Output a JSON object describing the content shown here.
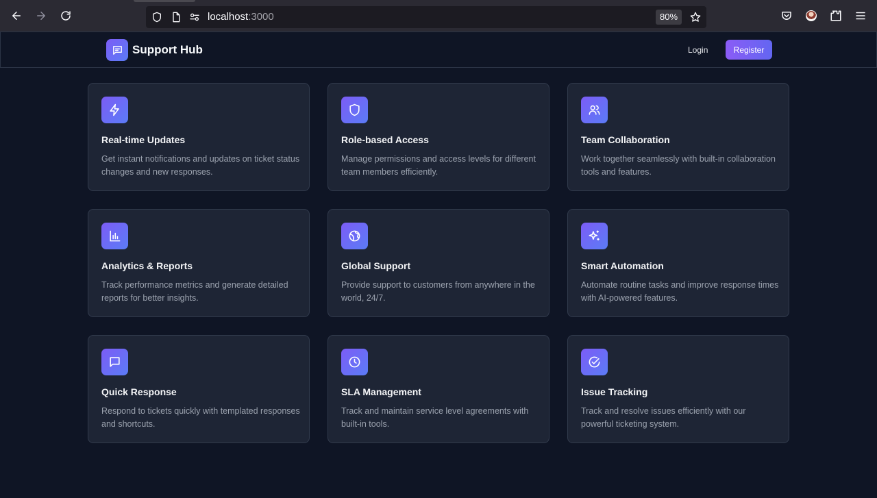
{
  "browser": {
    "url_host": "localhost",
    "url_port": ":3000",
    "zoom": "80%"
  },
  "navbar": {
    "brand": "Support Hub",
    "login_label": "Login",
    "register_label": "Register"
  },
  "features": [
    {
      "title": "Real-time Updates",
      "description": "Get instant notifications and updates on ticket status changes and new responses.",
      "icon": "lightning-icon"
    },
    {
      "title": "Role-based Access",
      "description": "Manage permissions and access levels for different team members efficiently.",
      "icon": "shield-icon"
    },
    {
      "title": "Team Collaboration",
      "description": "Work together seamlessly with built-in collaboration tools and features.",
      "icon": "users-icon"
    },
    {
      "title": "Analytics & Reports",
      "description": "Track performance metrics and generate detailed reports for better insights.",
      "icon": "bar-chart-icon"
    },
    {
      "title": "Global Support",
      "description": "Provide support to customers from anywhere in the world, 24/7.",
      "icon": "globe-icon"
    },
    {
      "title": "Smart Automation",
      "description": "Automate routine tasks and improve response times with AI-powered features.",
      "icon": "sparkles-icon"
    },
    {
      "title": "Quick Response",
      "description": "Respond to tickets quickly with templated responses and shortcuts.",
      "icon": "message-square-icon"
    },
    {
      "title": "SLA Management",
      "description": "Track and maintain service level agreements with built-in tools.",
      "icon": "clock-icon"
    },
    {
      "title": "Issue Tracking",
      "description": "Track and resolve issues efficiently with our powerful ticketing system.",
      "icon": "check-circle-icon"
    }
  ],
  "colors": {
    "background": "#0f1525",
    "card": "#1e2535",
    "accent_start": "#8b5cf6",
    "accent_end": "#6366f1"
  }
}
